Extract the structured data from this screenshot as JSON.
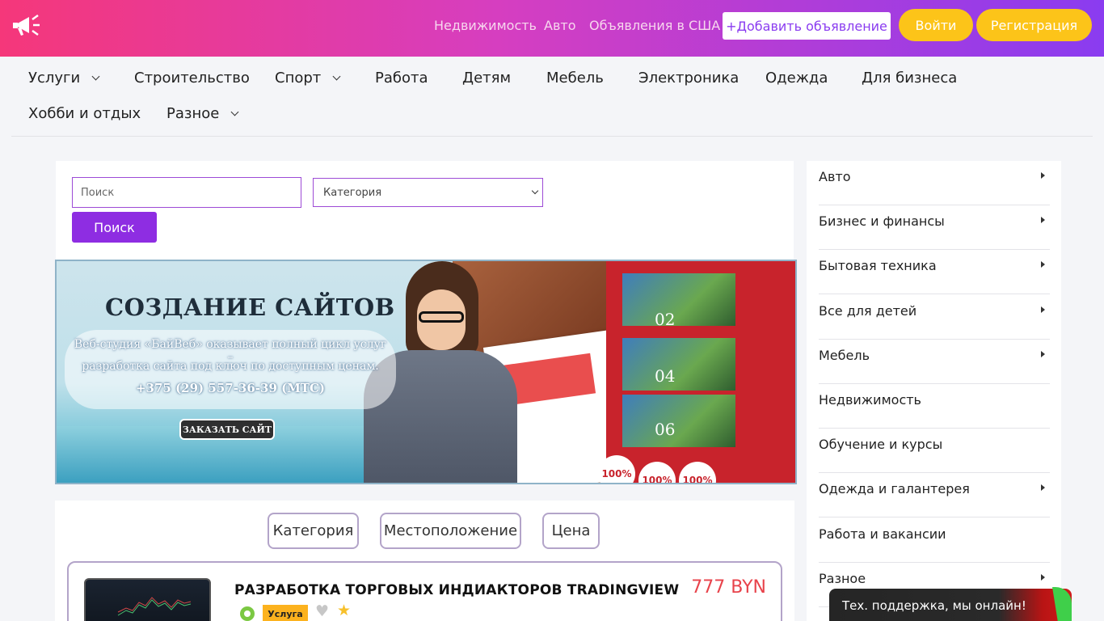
{
  "header": {
    "nav": [
      "Недвижимость",
      "Авто",
      "Объявления в США"
    ],
    "add_button": "+Добавить объявление",
    "login_button": "Войти",
    "register_button": "Регистрация"
  },
  "categories": [
    {
      "label": "Услуги",
      "dropdown": true
    },
    {
      "label": "Строительство",
      "dropdown": false
    },
    {
      "label": "Спорт",
      "dropdown": true
    },
    {
      "label": "Работа",
      "dropdown": false
    },
    {
      "label": "Детям",
      "dropdown": false
    },
    {
      "label": "Мебель",
      "dropdown": false
    },
    {
      "label": "Электроника",
      "dropdown": false
    },
    {
      "label": "Одежда",
      "dropdown": false
    },
    {
      "label": "Для бизнеса",
      "dropdown": false
    },
    {
      "label": "Хобби и отдых",
      "dropdown": false
    },
    {
      "label": "Разное",
      "dropdown": true
    }
  ],
  "search": {
    "placeholder": "Поиск",
    "category_select": "Категория",
    "button": "Поиск"
  },
  "banner": {
    "title": "СОЗДАНИЕ САЙТОВ",
    "line1": "Веб-студия «БайВеб» оказывает полный цикл услуг –",
    "line2": "разработка сайта под ключ по доступным ценам.",
    "phone": "+375 (29) 557-36-39 (МТС)",
    "cta": "ЗАКАЗАТЬ САЙТ",
    "brochure_numbers": [
      "02",
      "04",
      "06"
    ],
    "badge": "100%"
  },
  "filters": [
    "Категория",
    "Местоположение",
    "Цена"
  ],
  "listing": {
    "title": "РАЗРАБОТКА ТОРГОВЫХ ИНДИАКТОРОВ TRADINGVIEW",
    "price": "777 BYN",
    "tag": "Услуга"
  },
  "sidebar": [
    {
      "label": "Авто",
      "arrow": true
    },
    {
      "label": "Бизнес и финансы",
      "arrow": true
    },
    {
      "label": "Бытовая техника",
      "arrow": true
    },
    {
      "label": "Все для детей",
      "arrow": true
    },
    {
      "label": "Мебель",
      "arrow": true
    },
    {
      "label": "Недвижимость",
      "arrow": false
    },
    {
      "label": "Обучение и курсы",
      "arrow": false
    },
    {
      "label": "Одежда и галантерея",
      "arrow": true
    },
    {
      "label": "Работа и вакансии",
      "arrow": false
    },
    {
      "label": "Разное",
      "arrow": true
    }
  ],
  "chat": {
    "text": "Тех. поддержка, мы онлайн!"
  },
  "colors": {
    "accent": "#8e2de2",
    "yellow": "#fcc419",
    "price": "#e8434b"
  }
}
